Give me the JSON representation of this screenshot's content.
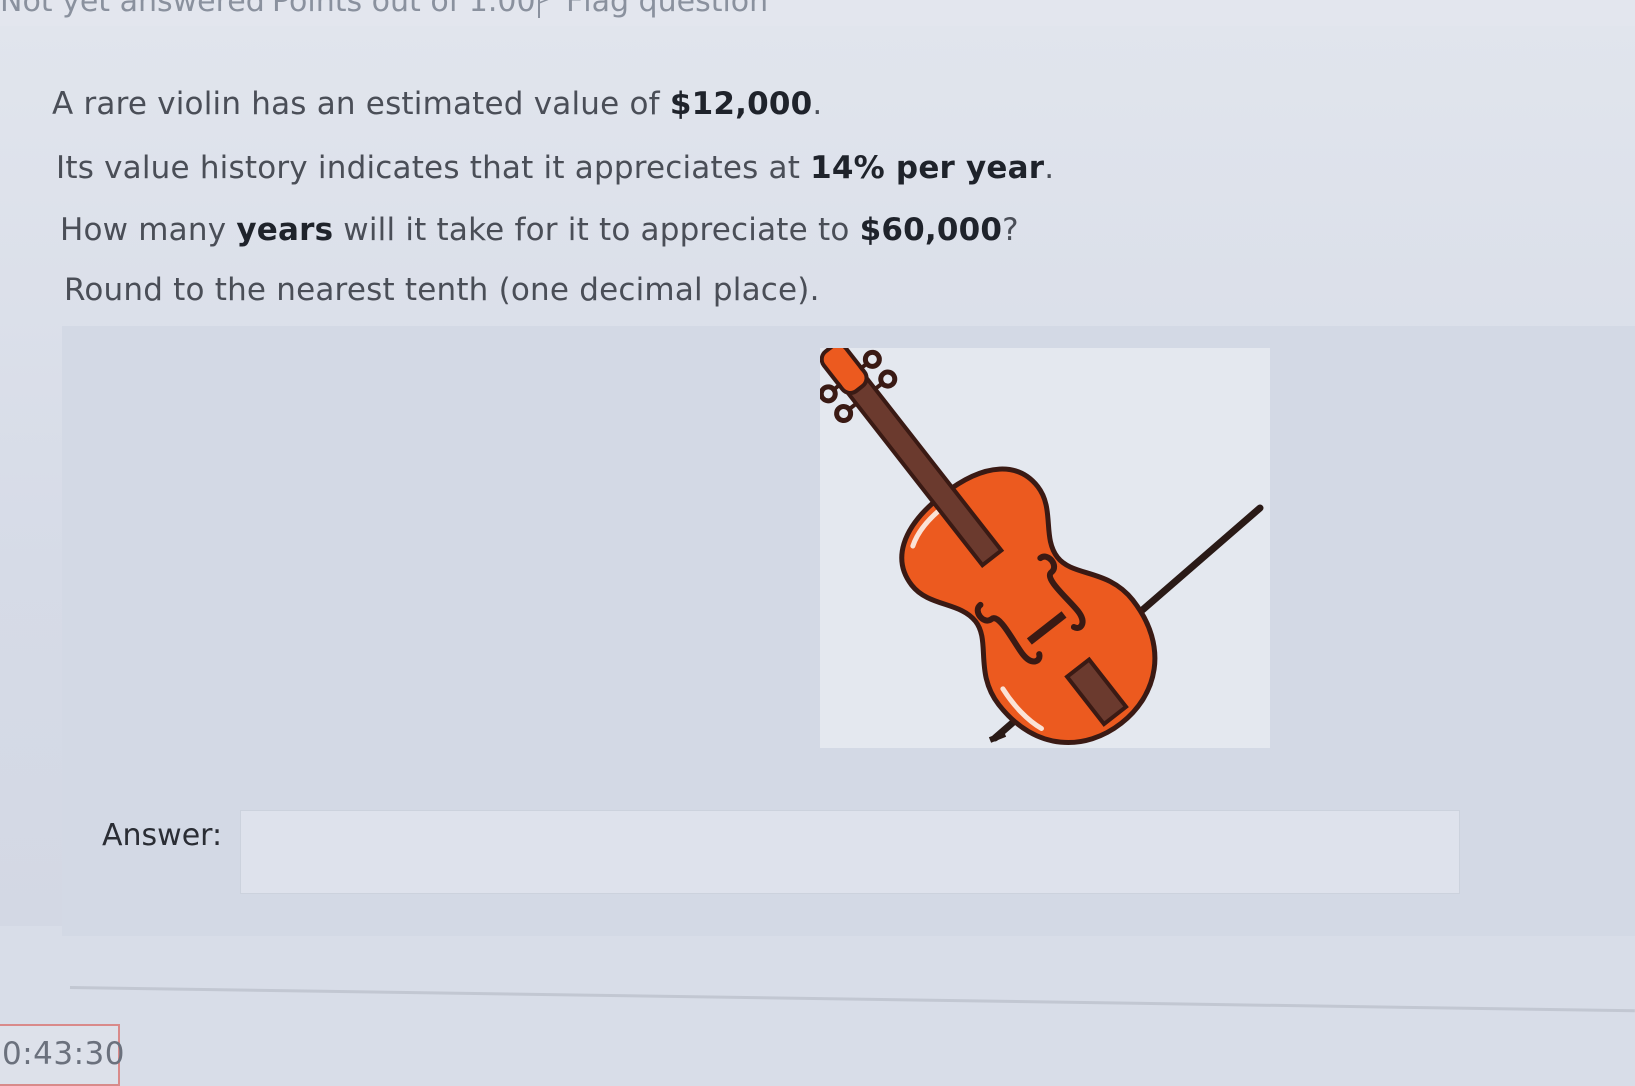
{
  "header": {
    "status": "Not yet answered",
    "points": "Points out of 1.00",
    "flag_label": "Flag question"
  },
  "question": {
    "line1_pre": "A rare violin has an estimated value of ",
    "line1_bold": "$12,000",
    "line1_post": ".",
    "line2_pre": "Its value history indicates that it appreciates at ",
    "line2_bold": "14% per year",
    "line2_post": ".",
    "line3_pre": "How many ",
    "line3_bold1": "years",
    "line3_mid": " will it take for it to appreciate to ",
    "line3_bold2": "$60,000",
    "line3_post": "?",
    "line4": "Round to the nearest tenth (one decimal place)."
  },
  "answer": {
    "label": "Answer:",
    "value": ""
  },
  "timer": {
    "text": "0:43:30"
  },
  "colors": {
    "violin_body": "#ec5a1f",
    "violin_outline": "#3a1a14",
    "fingerboard": "#6b3a2e",
    "timer_border": "#d98a8a"
  }
}
